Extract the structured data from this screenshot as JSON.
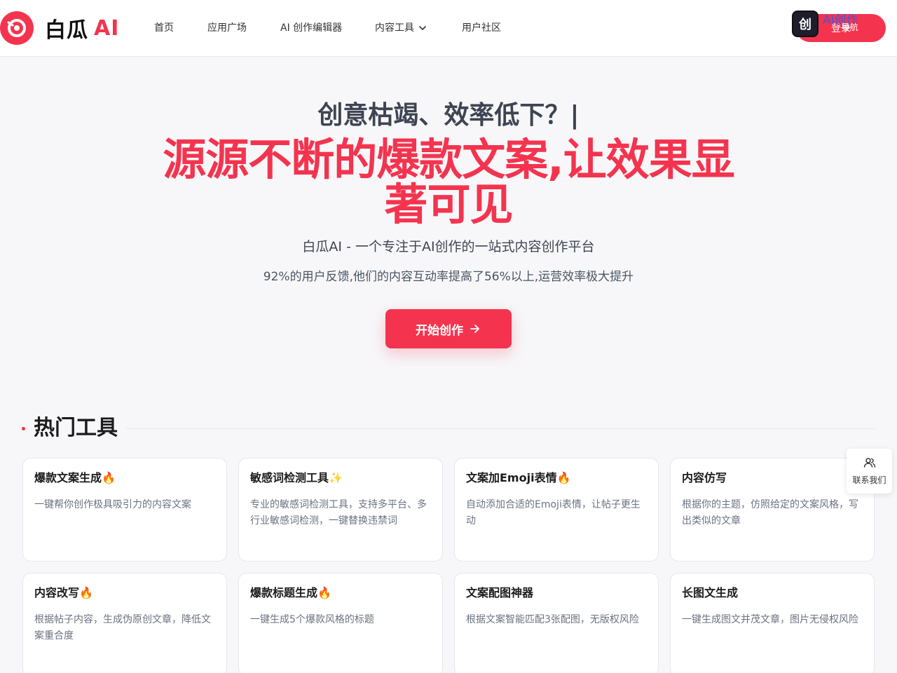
{
  "header": {
    "logo_name": "白瓜",
    "logo_ai": "AI",
    "nav": [
      {
        "label": "首页"
      },
      {
        "label": "应用广场"
      },
      {
        "label": "AI 创作编辑器"
      },
      {
        "label": "内容工具",
        "has_dropdown": true
      },
      {
        "label": "用户社区"
      }
    ],
    "login_label": "登录",
    "badge": {
      "icon_text": "创",
      "title": "AI创作",
      "sub": "导航"
    }
  },
  "hero": {
    "question": "创意枯竭、效率低下？|",
    "title": "源源不断的爆款文案,让效果显著可见",
    "desc1": "白瓜AI - 一个专注于AI创作的一站式内容创作平台",
    "desc2": "92%的用户反馈,他们的内容互动率提高了56%以上,运营效率极大提升",
    "cta_label": "开始创作"
  },
  "section": {
    "title": "热门工具"
  },
  "tools": [
    {
      "title": "爆款文案生成🔥",
      "desc": "一键帮你创作极具吸引力的内容文案"
    },
    {
      "title": "敏感词检测工具✨",
      "desc": "专业的敏感词检测工具，支持多平台、多行业敏感词检测，一键替换违禁词"
    },
    {
      "title": "文案加Emoji表情🔥",
      "desc": "自动添加合适的Emoji表情，让帖子更生动"
    },
    {
      "title": "内容仿写",
      "desc": "根据你的主题，仿照给定的文案风格，写出类似的文章"
    },
    {
      "title": "内容改写🔥",
      "desc": "根据帖子内容，生成伪原创文章，降低文案重合度"
    },
    {
      "title": "爆款标题生成🔥",
      "desc": "一键生成5个爆款风格的标题"
    },
    {
      "title": "文案配图神器",
      "desc": "根据文案智能匹配3张配图，无版权风险"
    },
    {
      "title": "长图文生成",
      "desc": "一键生成图文并茂文章，图片无侵权风险"
    }
  ],
  "contact": {
    "label": "联系我们"
  },
  "colors": {
    "brand": "#f4344f",
    "text": "#3e4452",
    "muted": "#6b7280"
  }
}
